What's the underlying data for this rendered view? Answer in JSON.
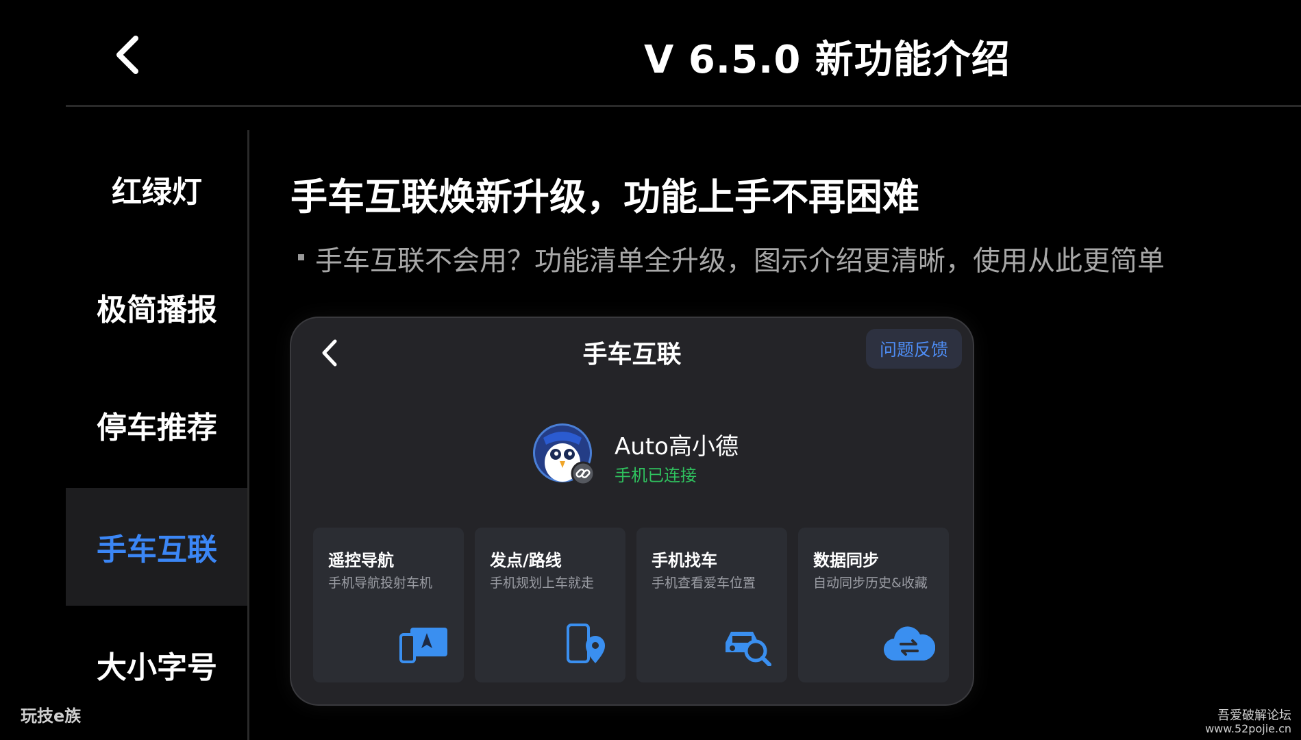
{
  "header": {
    "title": "V 6.5.0 新功能介绍",
    "back_icon": "chevron-left-icon"
  },
  "sidebar": {
    "items": [
      {
        "label": "红绿灯",
        "active": false
      },
      {
        "label": "极简播报",
        "active": false
      },
      {
        "label": "停车推荐",
        "active": false
      },
      {
        "label": "手车互联",
        "active": true
      },
      {
        "label": "大小字号",
        "active": false
      }
    ]
  },
  "content": {
    "title": "手车互联焕新升级，功能上手不再困难",
    "description": "手车互联不会用？功能清单全升级，图示介绍更清晰，使用从此更简单"
  },
  "preview": {
    "title": "手车互联",
    "feedback_label": "问题反馈",
    "user": {
      "name": "Auto高小德",
      "status": "手机已连接",
      "avatar_icon": "owl-mascot-avatar"
    },
    "tiles": [
      {
        "title": "遥控导航",
        "subtitle": "手机导航投射车机",
        "icon": "phone-to-screen-icon"
      },
      {
        "title": "发点/路线",
        "subtitle": "手机规划上车就走",
        "icon": "phone-location-icon"
      },
      {
        "title": "手机找车",
        "subtitle": "手机查看爱车位置",
        "icon": "car-search-icon"
      },
      {
        "title": "数据同步",
        "subtitle": "自动同步历史&收藏",
        "icon": "cloud-sync-icon"
      }
    ]
  },
  "watermarks": {
    "left": "玩技e族",
    "right_line1": "吾爱破解论坛",
    "right_line2": "www.52pojie.cn"
  },
  "colors": {
    "background": "#000000",
    "accent_blue": "#3b86f5",
    "status_green": "#2fc15e",
    "card_bg": "#242428",
    "tile_bg": "#2b2d33"
  }
}
